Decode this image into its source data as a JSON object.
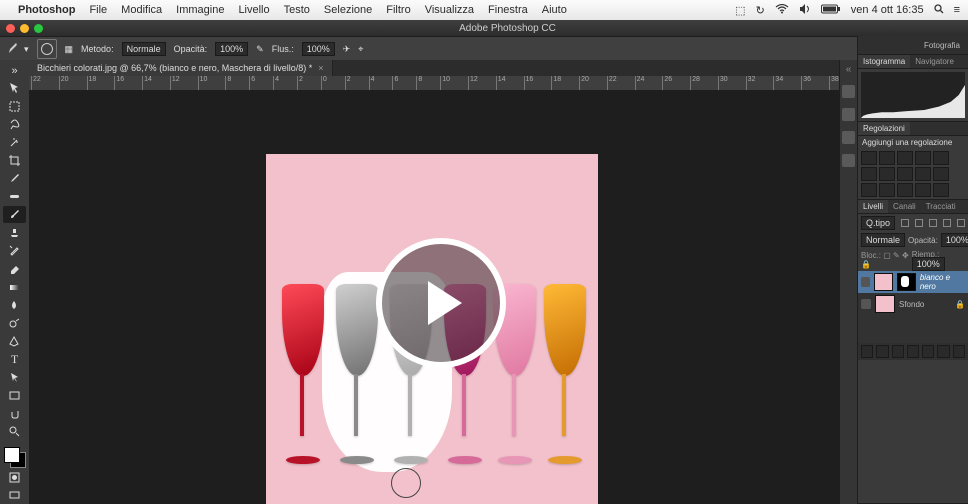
{
  "mac_menu": {
    "app": "Photoshop",
    "items": [
      "File",
      "Modifica",
      "Immagine",
      "Livello",
      "Testo",
      "Selezione",
      "Filtro",
      "Visualizza",
      "Finestra",
      "Aiuto"
    ],
    "clock": "ven 4 ott  16:35"
  },
  "window": {
    "title": "Adobe Photoshop CC"
  },
  "options_bar": {
    "mode_label": "Metodo:",
    "mode_value": "Normale",
    "opacity_label": "Opacità:",
    "opacity_value": "100%",
    "flow_label": "Flus.:",
    "flow_value": "100%"
  },
  "document_tab": {
    "label": "Bicchieri colorati.jpg @ 66,7% (bianco e nero, Maschera di livello/8) *"
  },
  "ruler_ticks": [
    "22",
    "20",
    "18",
    "16",
    "14",
    "12",
    "10",
    "8",
    "6",
    "4",
    "2",
    "0",
    "2",
    "4",
    "6",
    "8",
    "10",
    "12",
    "14",
    "16",
    "18",
    "20",
    "22",
    "24",
    "26",
    "28",
    "30",
    "32",
    "34",
    "36",
    "38"
  ],
  "right_panels": {
    "workspace_name": "Fotografia",
    "histogram_tab": "Istogramma",
    "navigator_tab": "Navigatore",
    "adjustments_tab": "Regolazioni",
    "adjustments_hint": "Aggiungi una regolazione",
    "layers_tab": "Livelli",
    "channels_tab": "Canali",
    "paths_tab": "Tracciati",
    "kind_label": "Q.tipo",
    "blend_mode": "Normale",
    "opacity_label": "Opacità:",
    "opacity_value": "100%",
    "lock_label": "Bloc.:",
    "fill_label": "Riemp.:",
    "fill_value": "100%",
    "layers": [
      {
        "name": "bianco e nero"
      },
      {
        "name": "Sfondo"
      }
    ]
  },
  "tool_names": [
    "move",
    "marquee",
    "lasso",
    "magic-wand",
    "crop",
    "eyedropper",
    "spot-heal",
    "brush",
    "clone",
    "history-brush",
    "eraser",
    "gradient",
    "blur",
    "dodge",
    "pen",
    "type",
    "path-select",
    "rectangle",
    "hand",
    "zoom"
  ]
}
